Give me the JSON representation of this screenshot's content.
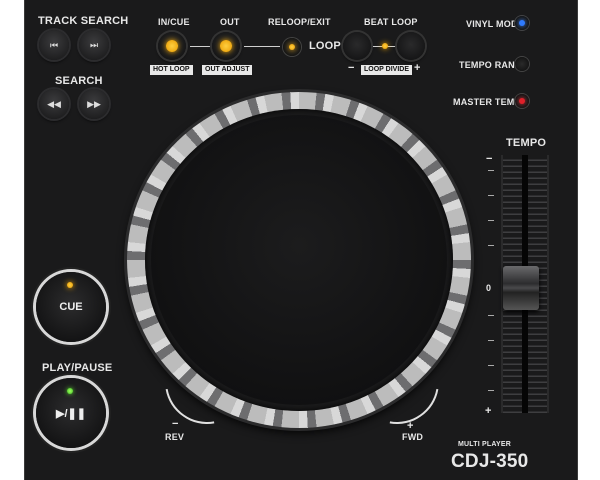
{
  "left": {
    "track_search": "TRACK SEARCH",
    "track_prev_icon": "⏮",
    "track_next_icon": "⏭",
    "search": "SEARCH",
    "search_rev_icon": "◀◀",
    "search_fwd_icon": "▶▶",
    "cue": "CUE",
    "play_pause_label": "PLAY/PAUSE",
    "play_pause_icon": "▶/❚❚"
  },
  "loop": {
    "in_cue": "IN/CUE",
    "out": "OUT",
    "reloop_exit": "RELOOP/EXIT",
    "loop": "LOOP",
    "hot_loop": "HOT LOOP",
    "out_adjust": "OUT ADJUST",
    "beat_loop": "BEAT LOOP",
    "loop_divide": "LOOP DIVIDE",
    "minus": "−",
    "plus": "+"
  },
  "right": {
    "vinyl_mode": "VINYL MODE",
    "tempo_range": "TEMPO RANGE",
    "master_tempo": "MASTER TEMPO",
    "tempo": "TEMPO",
    "fader_minus": "−",
    "fader_zero": "0",
    "fader_plus": "+",
    "multi_player": "MULTI PLAYER",
    "model": "CDJ-350"
  },
  "jog": {
    "rev_sign": "−",
    "rev": "REV",
    "fwd_sign": "+",
    "fwd": "FWD"
  },
  "colors": {
    "panel": "#1a1a1b",
    "amber": "#ffb000",
    "vinyl_led": "#2f7bff",
    "master_tempo_led": "#e0202a"
  }
}
